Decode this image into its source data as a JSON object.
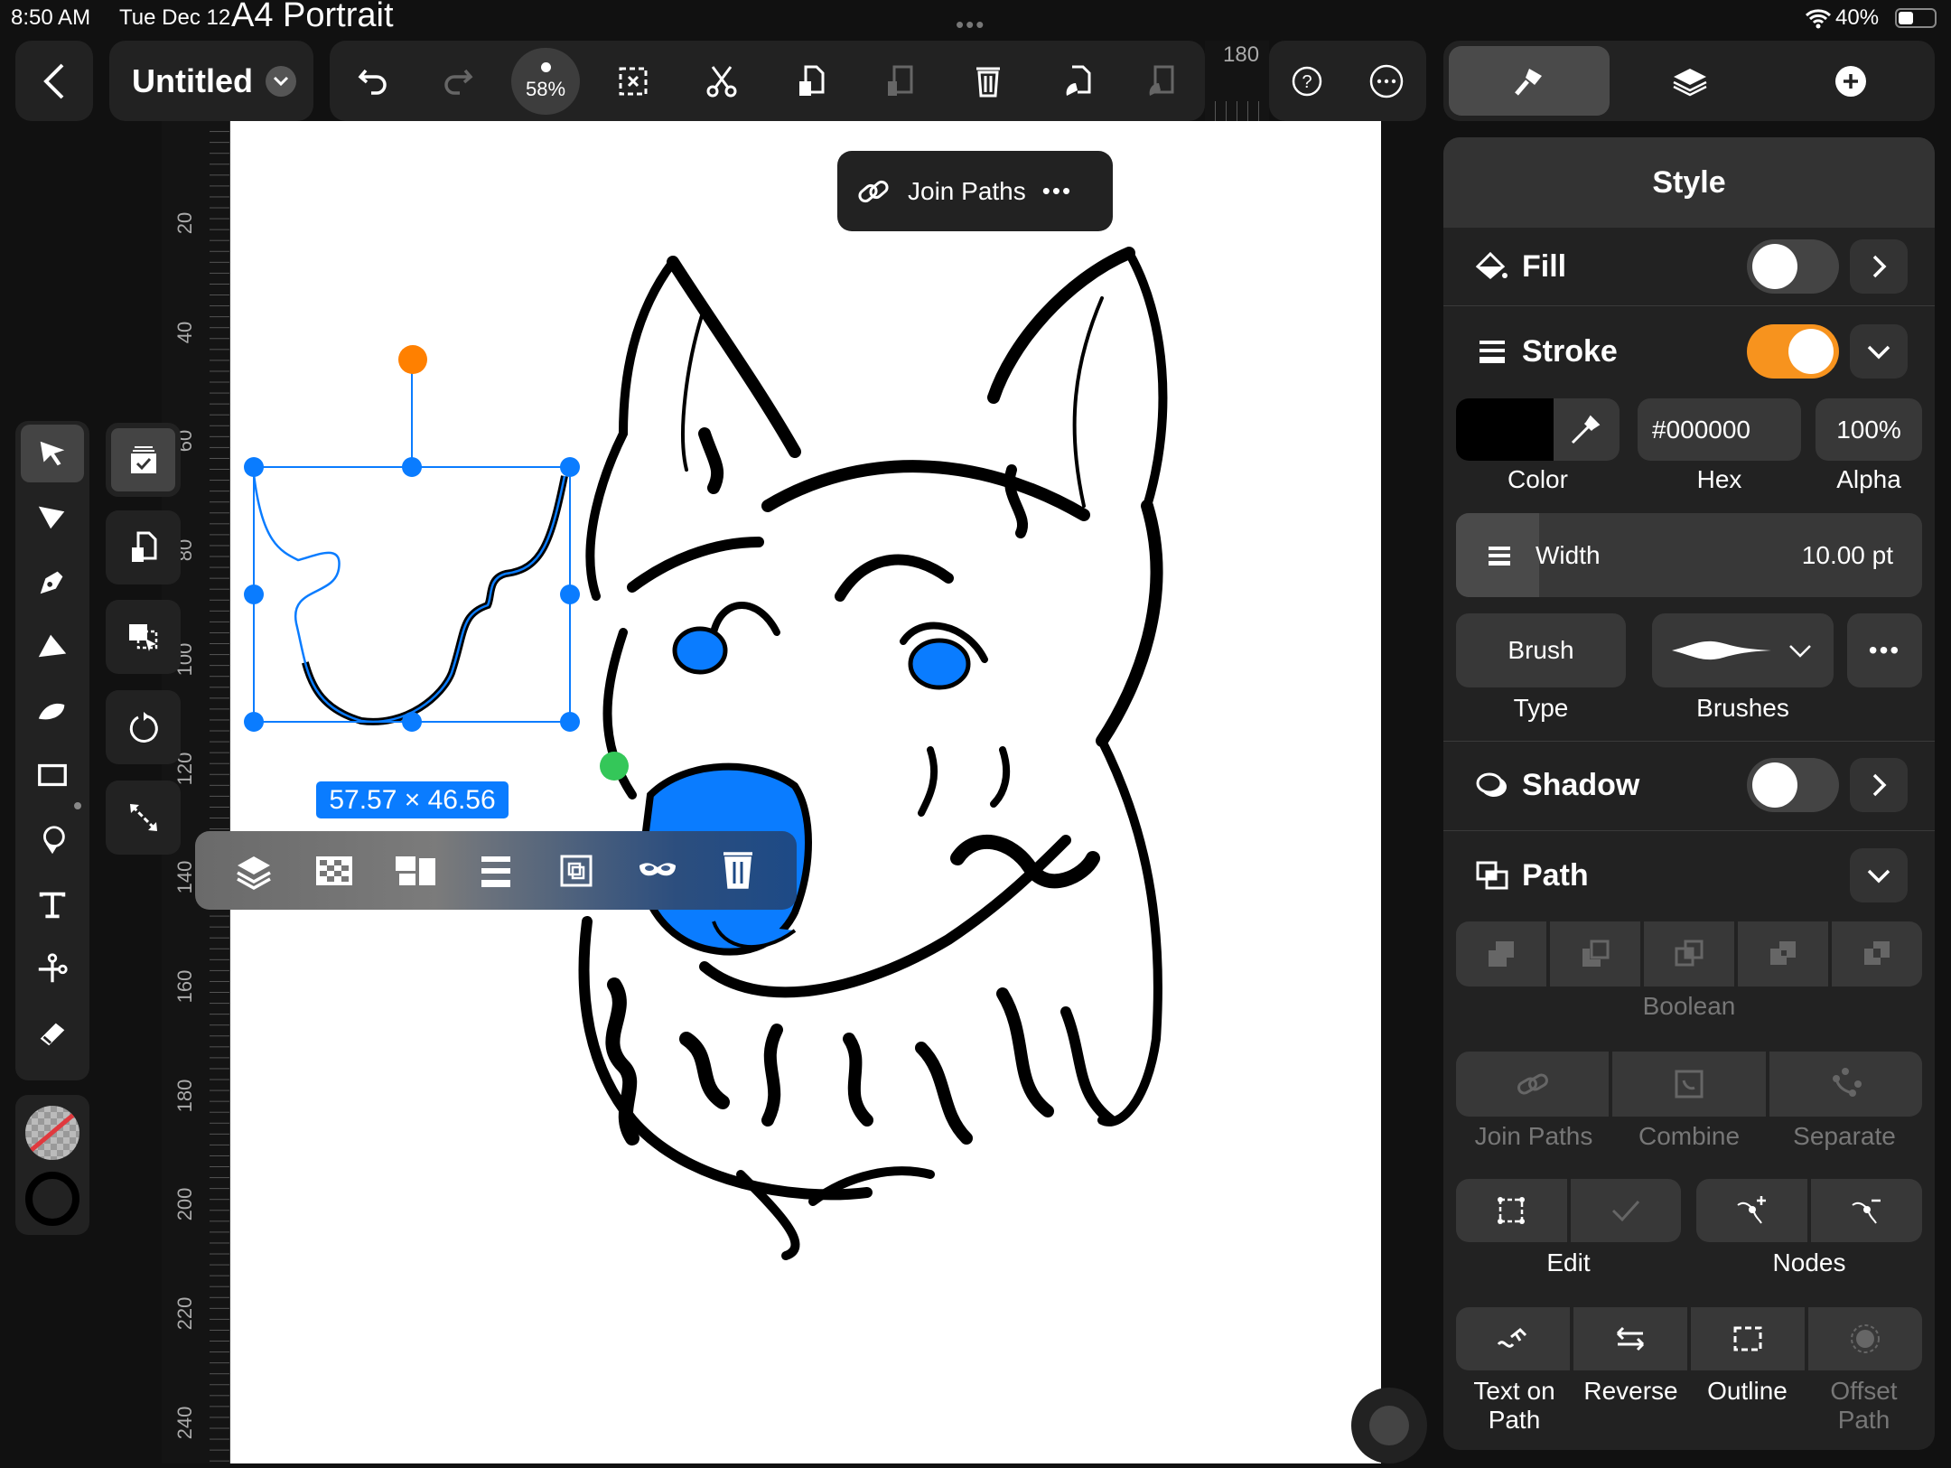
{
  "status_bar": {
    "time": "8:50 AM",
    "date": "Tue Dec 12",
    "battery": "40%",
    "icons": [
      "wifi-icon",
      "battery-icon"
    ]
  },
  "document": {
    "template": "A4 Portrait",
    "title": "Untitled"
  },
  "toolbar": {
    "zoom": "58%",
    "icons": [
      "undo-icon",
      "redo-icon",
      "deselect-icon",
      "cut-icon",
      "copy-icon",
      "paste-icon",
      "delete-icon",
      "copy-style-icon",
      "paste-style-icon"
    ]
  },
  "help": {
    "icons": [
      "help-icon",
      "more-icon"
    ]
  },
  "ruler": {
    "top_label": "180",
    "left_labels": [
      "20",
      "40",
      "60",
      "80",
      "100",
      "120",
      "140",
      "160",
      "180",
      "200",
      "220",
      "240"
    ]
  },
  "popup": {
    "label": "Join Paths"
  },
  "selection": {
    "dimensions": "57.57 × 46.56",
    "accent": "#0a7cff",
    "rotate_handle": "#ff8000",
    "anchor": "#34c759"
  },
  "tools": [
    "select",
    "direct-select",
    "pen",
    "vector-brush",
    "brush",
    "shape",
    "lasso",
    "text",
    "scissors",
    "eraser"
  ],
  "context_bar": [
    "arrange",
    "opacity",
    "align",
    "distribute",
    "boolean",
    "mask",
    "delete"
  ],
  "right_tabs": [
    "style",
    "layers",
    "add"
  ],
  "style": {
    "title": "Style",
    "fill": {
      "label": "Fill",
      "enabled": false
    },
    "stroke": {
      "label": "Stroke",
      "enabled": true,
      "color": "#000000",
      "hex": "#000000",
      "alpha": "100%",
      "color_label": "Color",
      "hex_label": "Hex",
      "alpha_label": "Alpha",
      "width_label": "Width",
      "width_value": "10.00 pt",
      "type_value": "Brush",
      "type_label": "Type",
      "brushes_label": "Brushes"
    },
    "shadow": {
      "label": "Shadow",
      "enabled": false
    },
    "path": {
      "label": "Path",
      "boolean_label": "Boolean",
      "join_paths": "Join Paths",
      "combine": "Combine",
      "separate": "Separate",
      "edit": "Edit",
      "nodes": "Nodes",
      "text_on_path_1": "Text on",
      "text_on_path_2": "Path",
      "reverse": "Reverse",
      "outline": "Outline",
      "offset_1": "Offset",
      "offset_2": "Path"
    }
  },
  "colors": {
    "accent_orange": "#f7931e",
    "blue": "#0a7cff"
  }
}
